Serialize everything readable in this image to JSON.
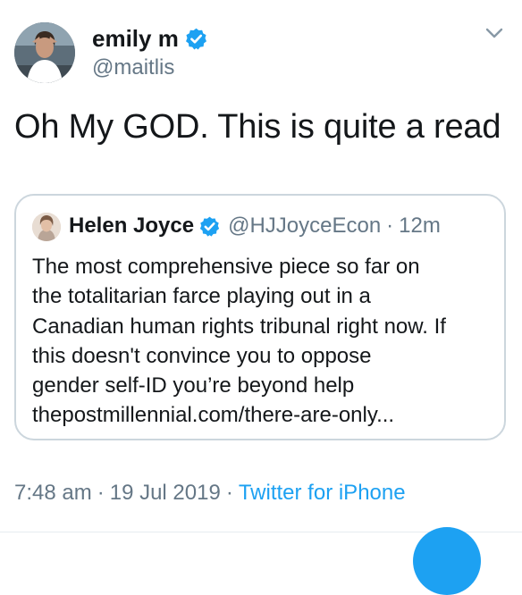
{
  "author": {
    "display_name": "emily m",
    "handle": "@maitlis"
  },
  "tweet": {
    "text": "Oh My GOD. This is quite a read"
  },
  "quoted": {
    "display_name": "Helen Joyce",
    "handle": "@HJJoyceEcon",
    "dot": "·",
    "time": "12m",
    "lines": [
      "The most comprehensive piece so far on",
      "the totalitarian farce playing out in a",
      "Canadian human rights tribunal right now. If",
      "this doesn't convince you to oppose",
      "gender self-ID you’re beyond help",
      "thepostmillennial.com/there-are-only..."
    ]
  },
  "meta": {
    "time": "7:48 am",
    "sep": "·",
    "date": "19 Jul 2019",
    "source": "Twitter for iPhone"
  },
  "colors": {
    "accent": "#1da1f2",
    "text": "#14171a",
    "secondary": "#657786",
    "border": "#ccd6dd"
  }
}
